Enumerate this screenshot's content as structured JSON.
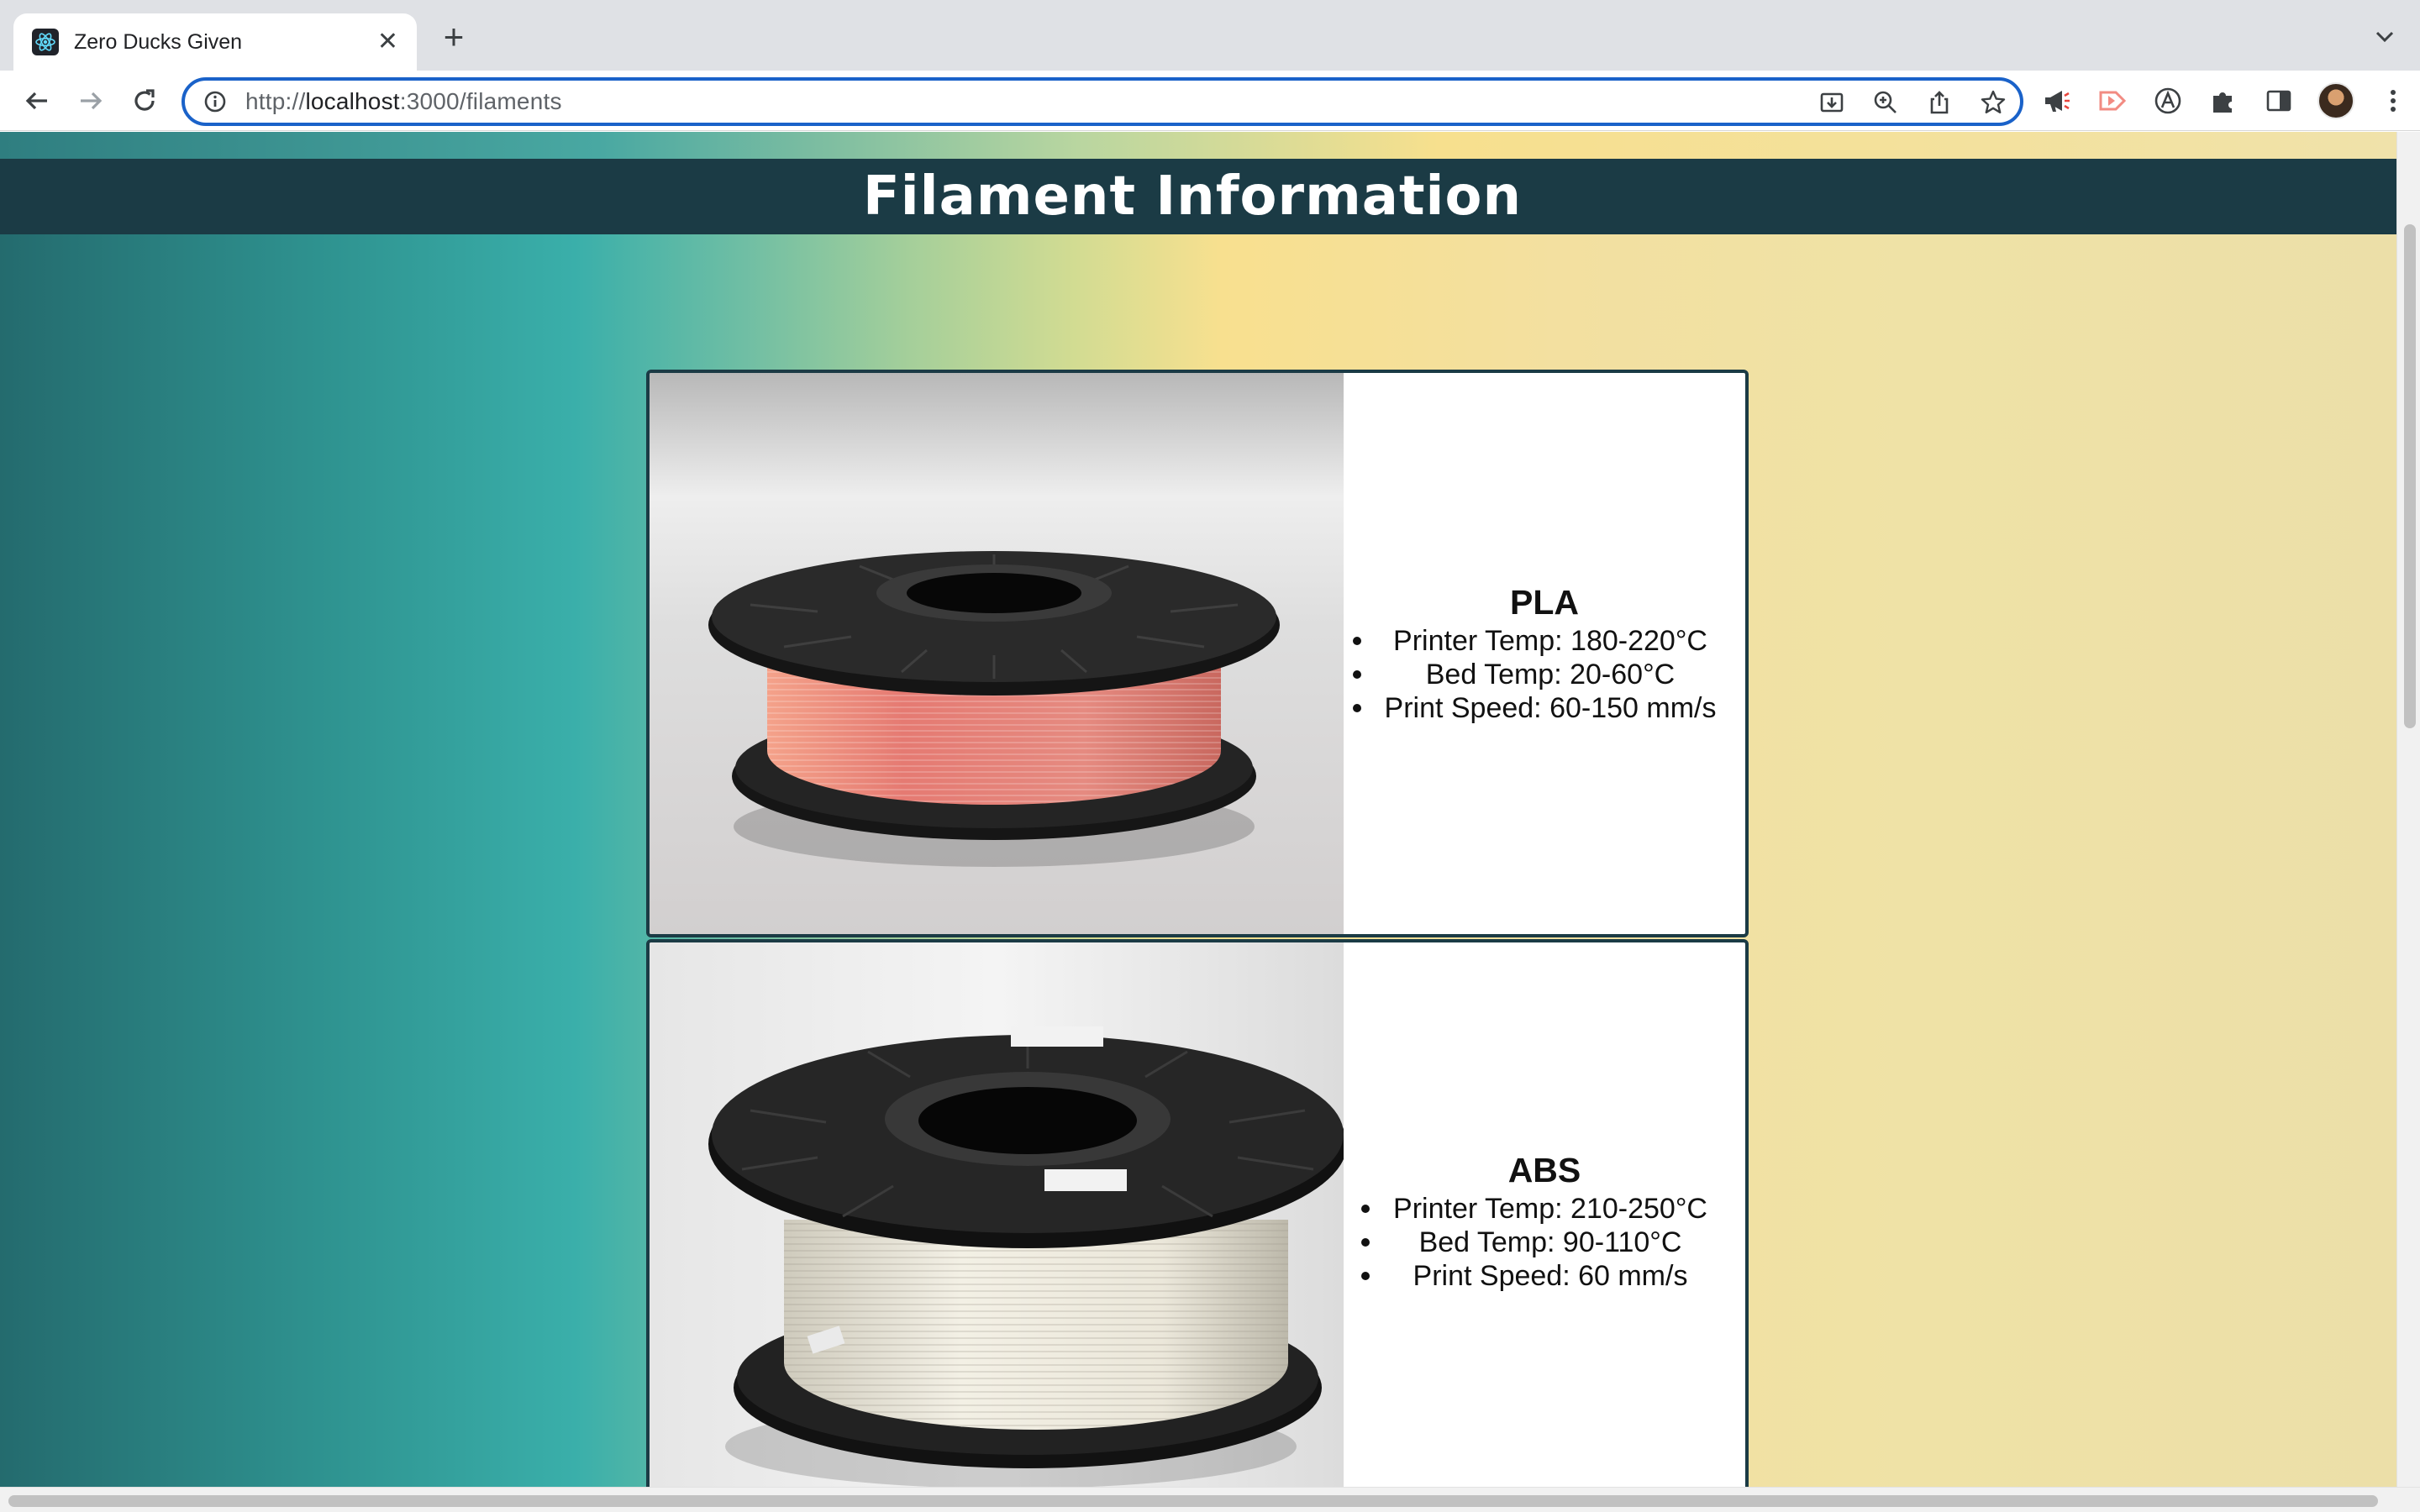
{
  "browser": {
    "tab_title": "Zero Ducks Given",
    "url_scheme": "http://",
    "url_host": "localhost",
    "url_path": ":3000/filaments"
  },
  "page": {
    "title": "Filament Information"
  },
  "filaments": [
    {
      "name": "PLA",
      "specs": [
        "Printer Temp: 180-220°C",
        "Bed Temp: 20-60°C",
        "Print Speed: 60-150 mm/s"
      ],
      "spool_color": "#e88a7e"
    },
    {
      "name": "ABS",
      "specs": [
        "Printer Temp: 210-250°C",
        "Bed Temp: 90-110°C",
        "Print Speed: 60 mm/s"
      ],
      "spool_color": "#ece8dc"
    }
  ],
  "colors": {
    "header_bg": "#1b3b45",
    "omnibox_border": "#1a62c9"
  }
}
